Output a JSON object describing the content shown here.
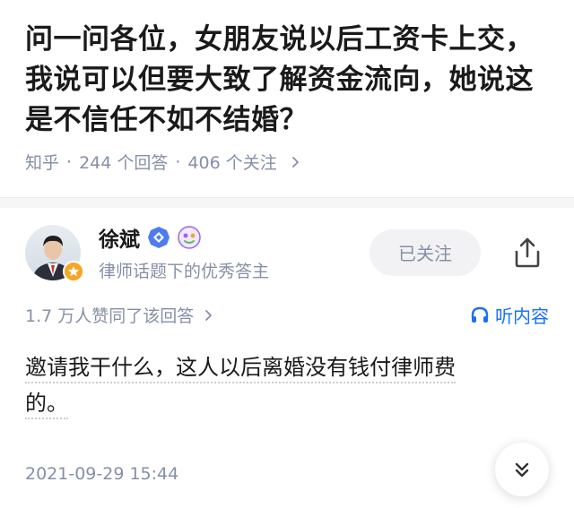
{
  "question": {
    "title": "问一问各位，女朋友说以后工资卡上交，我说可以但要大致了解资金流向，她说这是不信任不如不结婚？",
    "source": "知乎",
    "answers_count_label": "244 个回答",
    "followers_count_label": "406 个关注"
  },
  "author": {
    "name": "徐斌",
    "description": "律师话题下的优秀答主",
    "follow_label": "已关注"
  },
  "stats": {
    "likes_label": "1.7 万人赞同了该回答",
    "listen_label": "听内容"
  },
  "answer": {
    "line1": "邀请我干什么，这人以后离婚没有钱付律师费",
    "line2": "的。"
  },
  "footer": {
    "timestamp": "2021-09-29 15:44"
  },
  "colors": {
    "accent": "#1772f6",
    "meta_gray": "#8590a6",
    "badge_orange": "#f6a623"
  }
}
